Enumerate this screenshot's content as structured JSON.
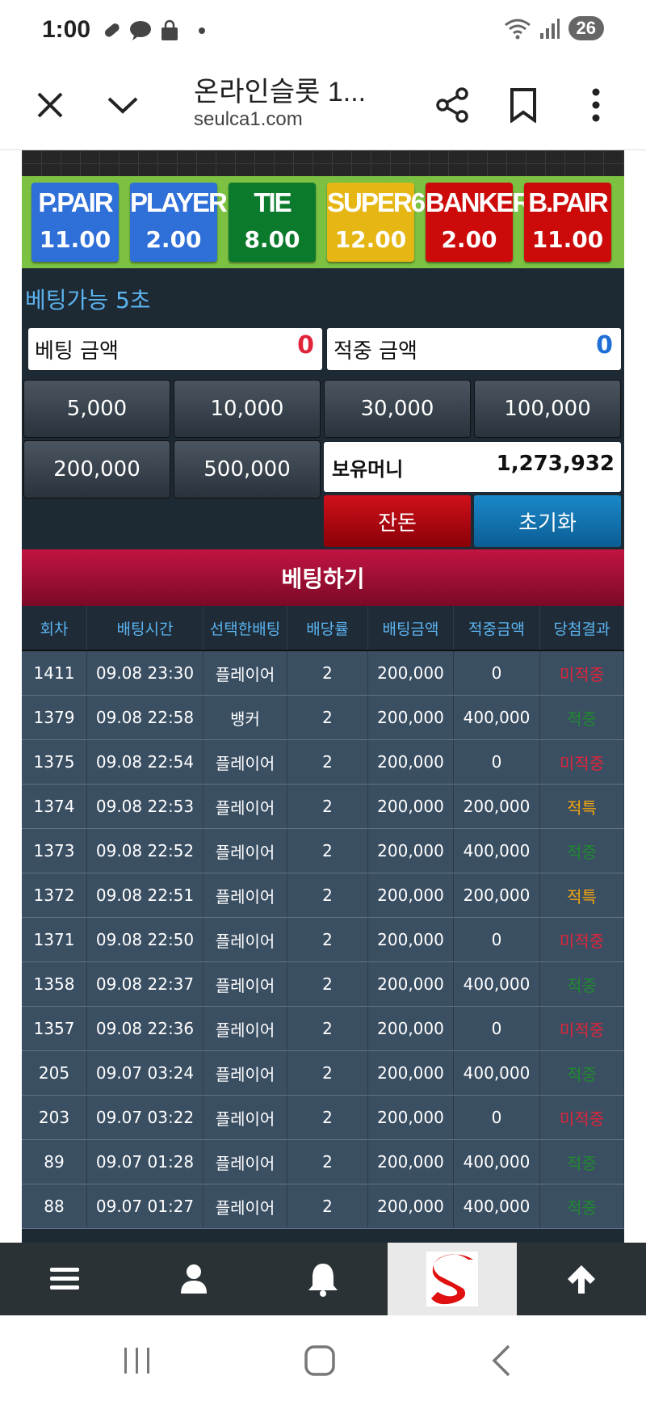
{
  "status": {
    "time": "1:00",
    "battery": "26"
  },
  "browser": {
    "title": "온라인슬롯 1...",
    "url": "seulca1.com"
  },
  "odds": [
    {
      "name": "P.PAIR",
      "value": "11.00",
      "color": "#2f6fd8"
    },
    {
      "name": "PLAYER",
      "value": "2.00",
      "color": "#2f6fd8"
    },
    {
      "name": "TIE",
      "value": "8.00",
      "color": "#0c7a2c"
    },
    {
      "name": "SUPER6",
      "value": "12.00",
      "color": "#e6b714"
    },
    {
      "name": "BANKER",
      "value": "2.00",
      "color": "#cc0a0a"
    },
    {
      "name": "B.PAIR",
      "value": "11.00",
      "color": "#cc0a0a"
    }
  ],
  "betting": {
    "timer": "베팅가능 5초",
    "bet_amount_label": "베팅 금액",
    "bet_amount_value": "0",
    "win_amount_label": "적중 금액",
    "win_amount_value": "0",
    "chips": [
      "5,000",
      "10,000",
      "30,000",
      "100,000",
      "200,000",
      "500,000"
    ],
    "balance_label": "보유머니",
    "balance_value": "1,273,932",
    "change_label": "잔돈",
    "reset_label": "초기화",
    "submit_label": "베팅하기"
  },
  "table": {
    "headers": [
      "회차",
      "배팅시간",
      "선택한배팅",
      "배당률",
      "배팅금액",
      "적중금액",
      "당첨결과"
    ],
    "rows": [
      [
        "1411",
        "09.08 23:30",
        "플레이어",
        "2",
        "200,000",
        "0",
        "미적중"
      ],
      [
        "1379",
        "09.08 22:58",
        "뱅커",
        "2",
        "200,000",
        "400,000",
        "적중"
      ],
      [
        "1375",
        "09.08 22:54",
        "플레이어",
        "2",
        "200,000",
        "0",
        "미적중"
      ],
      [
        "1374",
        "09.08 22:53",
        "플레이어",
        "2",
        "200,000",
        "200,000",
        "적특"
      ],
      [
        "1373",
        "09.08 22:52",
        "플레이어",
        "2",
        "200,000",
        "400,000",
        "적중"
      ],
      [
        "1372",
        "09.08 22:51",
        "플레이어",
        "2",
        "200,000",
        "200,000",
        "적특"
      ],
      [
        "1371",
        "09.08 22:50",
        "플레이어",
        "2",
        "200,000",
        "0",
        "미적중"
      ],
      [
        "1358",
        "09.08 22:37",
        "플레이어",
        "2",
        "200,000",
        "400,000",
        "적중"
      ],
      [
        "1357",
        "09.08 22:36",
        "플레이어",
        "2",
        "200,000",
        "0",
        "미적중"
      ],
      [
        "205",
        "09.07 03:24",
        "플레이어",
        "2",
        "200,000",
        "400,000",
        "적중"
      ],
      [
        "203",
        "09.07 03:22",
        "플레이어",
        "2",
        "200,000",
        "0",
        "미적중"
      ],
      [
        "89",
        "09.07 01:28",
        "플레이어",
        "2",
        "200,000",
        "400,000",
        "적중"
      ],
      [
        "88",
        "09.07 01:27",
        "플레이어",
        "2",
        "200,000",
        "400,000",
        "적중"
      ]
    ],
    "result_colors": {
      "미적중": "#e0243a",
      "적중": "#1f8a2e",
      "적특": "#f2a50c"
    }
  },
  "nav": {
    "icons": [
      "menu-icon",
      "user-icon",
      "bell-icon",
      "site-logo",
      "arrow-up-icon"
    ]
  }
}
